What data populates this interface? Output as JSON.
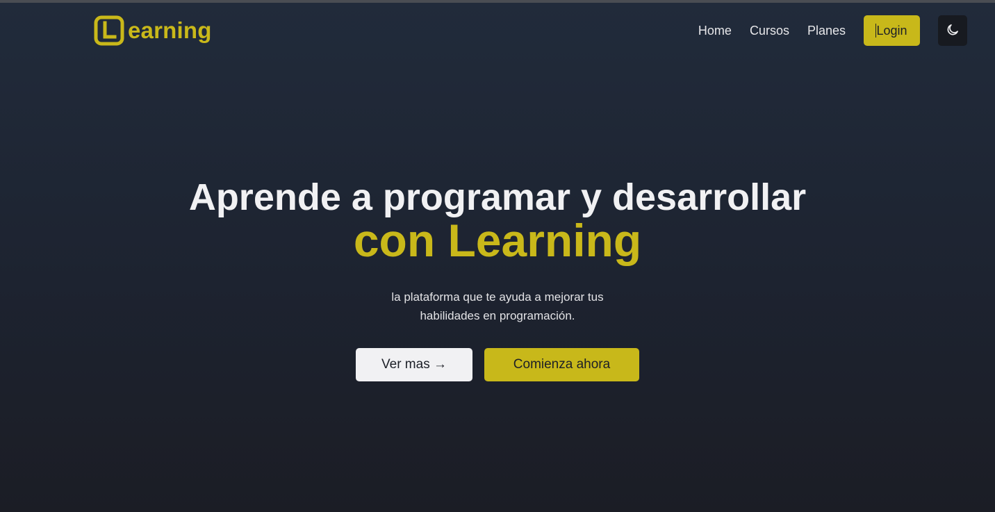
{
  "brand": {
    "logo_letter": "L",
    "name": "earning",
    "color": "#c9b81a"
  },
  "nav": {
    "links": [
      {
        "label": "Home"
      },
      {
        "label": "Cursos"
      },
      {
        "label": "Planes"
      }
    ],
    "login_label": "Login",
    "theme_icon": "moon-icon"
  },
  "hero": {
    "title": "Aprende a programar y desarrollar",
    "title_accent": "con Learning",
    "subtitle": "la plataforma que te ayuda a mejorar tus habilidades en programación.",
    "secondary_button": "Ver mas →",
    "primary_button": "Comienza ahora"
  },
  "colors": {
    "accent": "#c8b81a",
    "background_top": "#212b3b",
    "background_bottom": "#1b1d25",
    "light_button": "#f1f1f3"
  }
}
